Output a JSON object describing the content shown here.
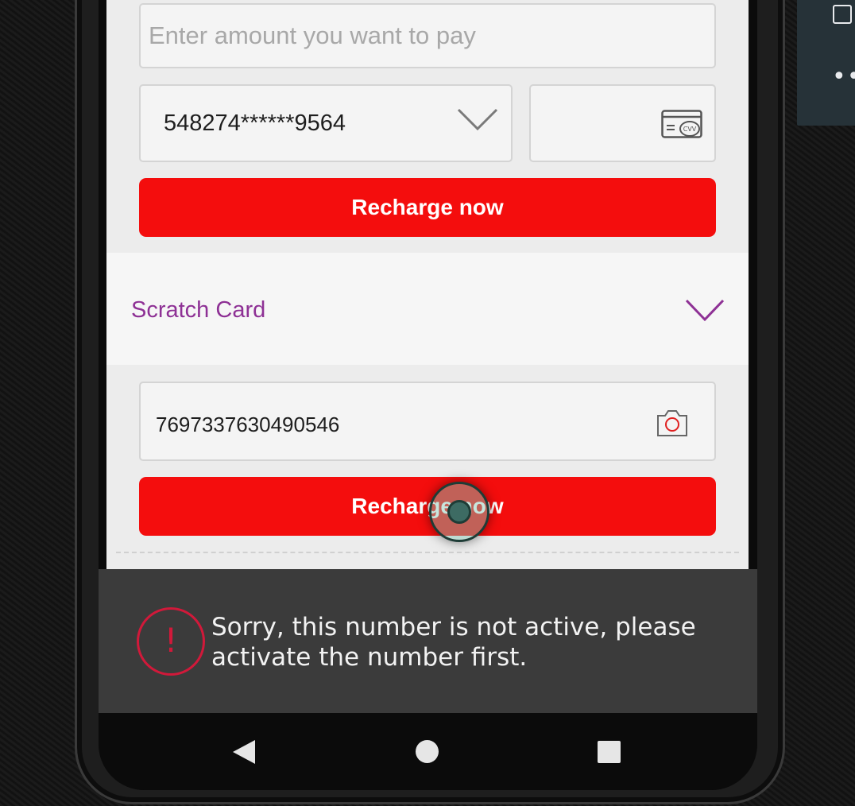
{
  "emulator": {
    "icons": [
      "square-icon",
      "more-icon"
    ]
  },
  "payment": {
    "amount_placeholder": "Enter amount you want to pay",
    "card_number": "548274******9564",
    "cvv_icon_label": "CVV",
    "recharge_label": "Recharge now"
  },
  "scratch_card": {
    "title": "Scratch Card",
    "voucher_number": "7697337630490546",
    "recharge_label": "Recharge now"
  },
  "toast": {
    "message": "Sorry, this number is not active, please activate the number first.",
    "icon": "alert-icon",
    "icon_glyph": "!"
  },
  "colors": {
    "accent_red": "#f40d0d",
    "scratch_purple": "#8e3195",
    "alert_red": "#d1193a"
  }
}
